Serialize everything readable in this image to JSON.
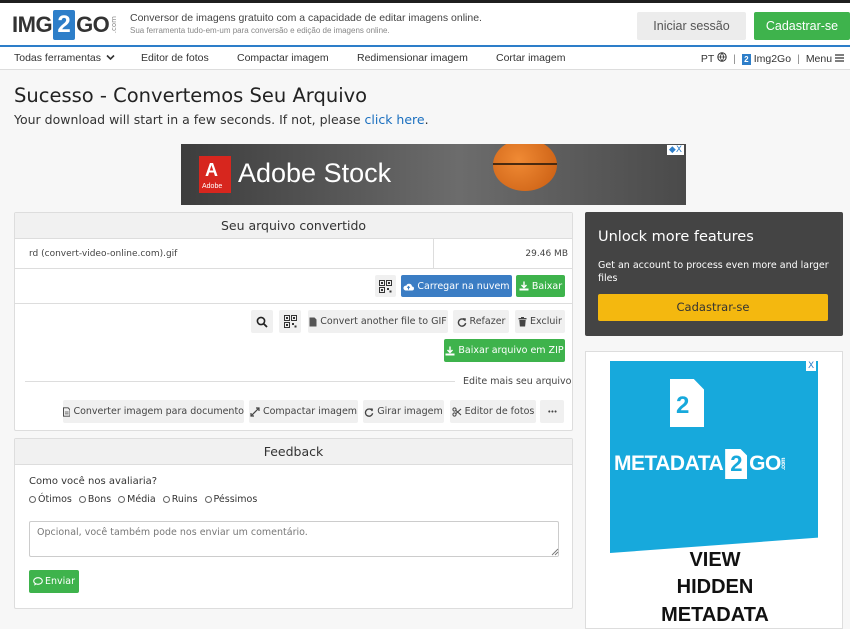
{
  "header": {
    "logo_left": "IMG",
    "logo_mid": "2",
    "logo_right": "GO",
    "logo_com": ".com",
    "tagline": "Conversor de imagens gratuito com a capacidade de editar imagens online.",
    "tagline_small": "Sua ferramenta tudo-em-um para conversão e edição de imagens online.",
    "login_label": "Iniciar sessão",
    "signup_label": "Cadastrar-se"
  },
  "nav": {
    "all_tools": "Todas ferramentas",
    "items": [
      "Editor de fotos",
      "Compactar imagem",
      "Redimensionar imagem",
      "Cortar imagem"
    ],
    "lang": "PT",
    "brand": "Img2Go",
    "menu": "Menu",
    "sep": "|"
  },
  "page": {
    "title": "Sucesso - Convertemos Seu Arquivo",
    "subtitle": "Your download will start in a few seconds. If not, please ",
    "subtitle_link": "click here",
    "subtitle_end": "."
  },
  "ad_banner": {
    "logo_letter": "A",
    "logo_word": "Adobe",
    "text": "Adobe Stock",
    "close": "◆X"
  },
  "converted": {
    "heading": "Seu arquivo convertido",
    "file_name": "rd (convert-video-online.com).gif",
    "file_size": "29.46 MB",
    "cloud_label": "Carregar na nuvem",
    "download_label": "Baixar",
    "convert_another": "Convert another file to GIF",
    "redo": "Refazer",
    "delete": "Excluir",
    "zip_label": "Baixar arquivo em ZIP",
    "edit_more": "Edite mais seu arquivo",
    "tools": [
      "Converter imagem para documento",
      "Compactar imagem",
      "Girar imagem",
      "Editor de fotos"
    ],
    "more": "•••"
  },
  "feedback": {
    "heading": "Feedback",
    "question": "Como você nos avaliaria?",
    "options": [
      "Ótimos",
      "Bons",
      "Média",
      "Ruins",
      "Péssimos"
    ],
    "placeholder": "Opcional, você também pode nos enviar um comentário.",
    "send": "Enviar"
  },
  "unlock": {
    "title": "Unlock more features",
    "desc": "Get an account to process even more and larger files",
    "button": "Cadastrar-se"
  },
  "side_ad": {
    "doc_digit": "2",
    "word_left": "METADATA",
    "word_mid": "2",
    "word_right": "GO",
    "word_com": ".com",
    "line1": "VIEW",
    "line2": "HIDDEN",
    "line3": "METADATA",
    "close": "X"
  },
  "colors": {
    "brand_blue": "#2d7ec9",
    "green": "#3eb34c",
    "cloud_blue": "#3b7dc4",
    "yellow": "#f4b80f",
    "cyan": "#17a9dc"
  }
}
